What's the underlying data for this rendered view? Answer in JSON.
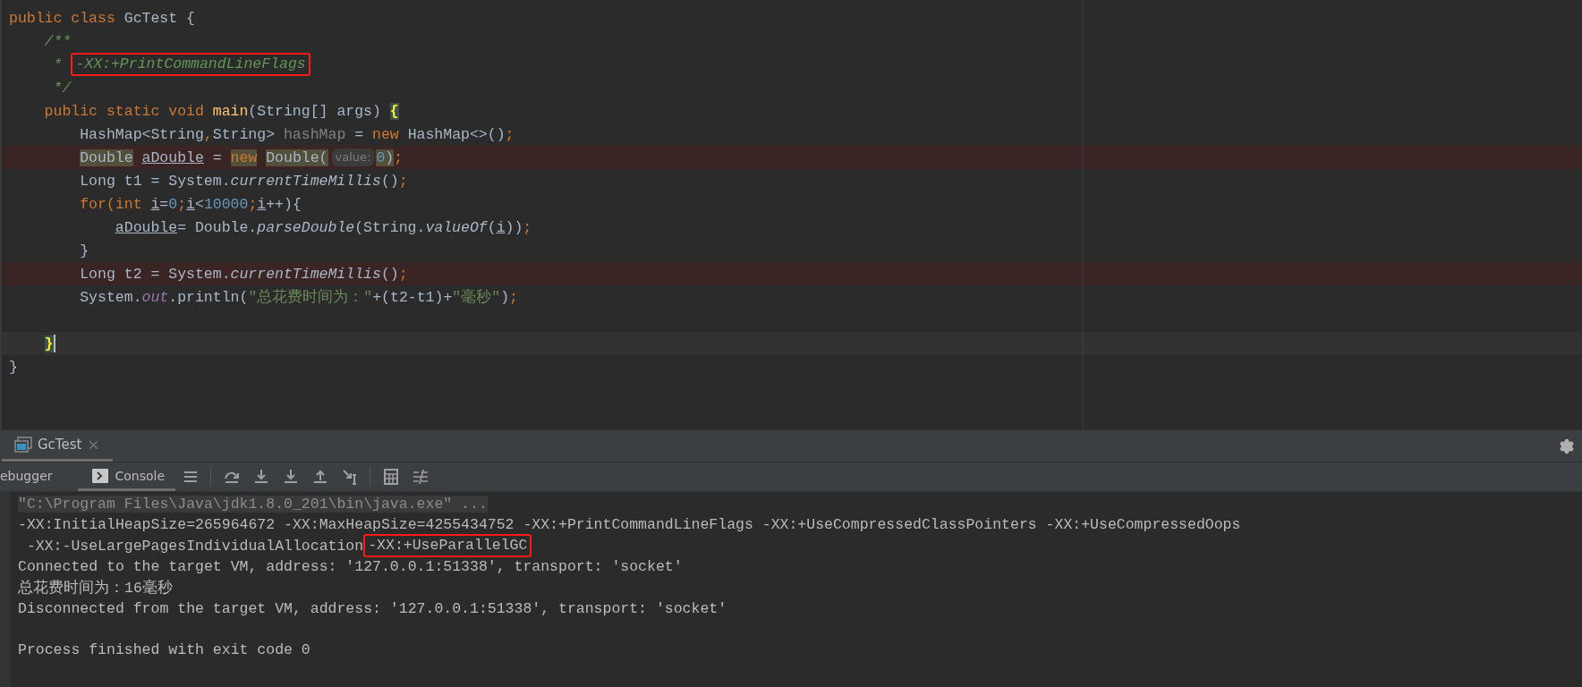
{
  "editor": {
    "lines": [
      {
        "kind": "normal",
        "tokens": [
          {
            "t": "public class",
            "kind": "kw"
          },
          {
            "t": " GcTest {",
            "kind": "plain"
          }
        ]
      },
      {
        "kind": "normal",
        "tokens": [
          {
            "t": "    /**",
            "kind": "comment"
          }
        ]
      },
      {
        "kind": "normal",
        "tokens": [
          {
            "t": "     * ",
            "kind": "comment"
          },
          {
            "t": "-XX:+PrintCommandLineFlags",
            "kind": "boxed-comment"
          }
        ]
      },
      {
        "kind": "normal",
        "tokens": [
          {
            "t": "     */",
            "kind": "comment"
          }
        ]
      },
      {
        "kind": "normal",
        "tokens": [
          {
            "t": "    public static void",
            "kind": "kw"
          },
          {
            "t": " main",
            "kind": "method"
          },
          {
            "t": "(String[] args) ",
            "kind": "plain"
          },
          {
            "t": "{",
            "kind": "brace"
          }
        ]
      },
      {
        "kind": "normal",
        "tokens": [
          {
            "t": "        HashMap<String",
            "kind": "plain"
          },
          {
            "t": ",",
            "kind": "kw"
          },
          {
            "t": "String> ",
            "kind": "plain"
          },
          {
            "t": "hashMap",
            "kind": "unused"
          },
          {
            "t": " = ",
            "kind": "plain"
          },
          {
            "t": "new",
            "kind": "kw"
          },
          {
            "t": " HashMap<>()",
            "kind": "plain"
          },
          {
            "t": ";",
            "kind": "kw"
          }
        ]
      },
      {
        "kind": "marked",
        "tokens": [
          {
            "t": "        Double",
            "kind": "marked-plain"
          },
          {
            "t": " aDouble",
            "kind": "reassigned"
          },
          {
            "t": " = ",
            "kind": "plain"
          },
          {
            "t": "new",
            "kind": "marked-kw"
          },
          {
            "t": " Double(",
            "kind": "marked-plain"
          },
          {
            "t": "value:",
            "kind": "hint"
          },
          {
            "t": "0",
            "kind": "marked-number"
          },
          {
            "t": ")",
            "kind": "marked-plain"
          },
          {
            "t": ";",
            "kind": "kw"
          }
        ]
      },
      {
        "kind": "normal",
        "tokens": [
          {
            "t": "        Long t1 = System.",
            "kind": "plain"
          },
          {
            "t": "currentTimeMillis",
            "kind": "static-call"
          },
          {
            "t": "()",
            "kind": "plain"
          },
          {
            "t": ";",
            "kind": "kw"
          }
        ]
      },
      {
        "kind": "normal",
        "tokens": [
          {
            "t": "        for(int ",
            "kind": "kw"
          },
          {
            "t": "i",
            "kind": "reassigned"
          },
          {
            "t": "=",
            "kind": "plain"
          },
          {
            "t": "0",
            "kind": "number"
          },
          {
            "t": ";",
            "kind": "kw"
          },
          {
            "t": "i",
            "kind": "reassigned"
          },
          {
            "t": "<",
            "kind": "plain"
          },
          {
            "t": "10000",
            "kind": "number"
          },
          {
            "t": ";",
            "kind": "kw"
          },
          {
            "t": "i",
            "kind": "reassigned"
          },
          {
            "t": "++){",
            "kind": "plain"
          }
        ]
      },
      {
        "kind": "normal",
        "tokens": [
          {
            "t": "            aDouble",
            "kind": "reassigned"
          },
          {
            "t": "= Double.",
            "kind": "plain"
          },
          {
            "t": "parseDouble",
            "kind": "static-call"
          },
          {
            "t": "(String.",
            "kind": "plain"
          },
          {
            "t": "valueOf",
            "kind": "static-call"
          },
          {
            "t": "(",
            "kind": "plain"
          },
          {
            "t": "i",
            "kind": "reassigned"
          },
          {
            "t": "))",
            "kind": "plain"
          },
          {
            "t": ";",
            "kind": "kw"
          }
        ]
      },
      {
        "kind": "normal",
        "tokens": [
          {
            "t": "        }",
            "kind": "plain"
          }
        ]
      },
      {
        "kind": "marked",
        "tokens": [
          {
            "t": "        Long t2 = System.",
            "kind": "plain"
          },
          {
            "t": "currentTimeMillis",
            "kind": "static-call"
          },
          {
            "t": "()",
            "kind": "plain"
          },
          {
            "t": ";",
            "kind": "kw"
          }
        ]
      },
      {
        "kind": "normal",
        "tokens": [
          {
            "t": "        System.",
            "kind": "plain"
          },
          {
            "t": "out",
            "kind": "static-field"
          },
          {
            "t": ".println(",
            "kind": "plain"
          },
          {
            "t": "\"总花费时间为：\"",
            "kind": "string"
          },
          {
            "t": "+(t2-t1)+",
            "kind": "plain"
          },
          {
            "t": "\"毫秒\"",
            "kind": "string"
          },
          {
            "t": ")",
            "kind": "plain"
          },
          {
            "t": ";",
            "kind": "kw"
          }
        ]
      },
      {
        "kind": "blank"
      },
      {
        "kind": "current",
        "tokens": [
          {
            "t": "    }",
            "kind": "brace"
          }
        ]
      },
      {
        "kind": "normal",
        "tokens": [
          {
            "t": "}",
            "kind": "plain"
          }
        ]
      }
    ]
  },
  "tool_window": {
    "tabs": [
      {
        "label": "GcTest",
        "selected": true
      }
    ],
    "sub_tabs": [
      {
        "label": "ebugger",
        "selected": false
      },
      {
        "label": "Console",
        "selected": true
      }
    ]
  },
  "console": {
    "lines": [
      {
        "kind": "text",
        "segments": [
          {
            "t": "\"C:\\Program Files\\Java\\jdk1.8.0_201\\bin\\java.exe\" ...",
            "kind": "command"
          }
        ]
      },
      {
        "kind": "text",
        "segments": [
          {
            "t": "-XX:InitialHeapSize=265964672 -XX:MaxHeapSize=4255434752 -XX:+PrintCommandLineFlags -XX:+UseCompressedClassPointers -XX:+UseCompressedOops",
            "kind": "plain"
          }
        ]
      },
      {
        "kind": "text",
        "segments": [
          {
            "t": " -XX:-UseLargePagesIndividualAllocation",
            "kind": "plain"
          },
          {
            "t": "-XX:+UseParallelGC",
            "kind": "boxed"
          }
        ]
      },
      {
        "kind": "text",
        "segments": [
          {
            "t": "Connected to the target VM, address: '127.0.0.1:51338', transport: 'socket'",
            "kind": "plain"
          }
        ]
      },
      {
        "kind": "text",
        "segments": [
          {
            "t": "总花费时间为：16毫秒",
            "kind": "plain"
          }
        ]
      },
      {
        "kind": "text",
        "segments": [
          {
            "t": "Disconnected from the target VM, address: '127.0.0.1:51338', transport: 'socket'",
            "kind": "plain"
          }
        ]
      },
      {
        "kind": "blank"
      },
      {
        "kind": "text",
        "segments": [
          {
            "t": "Process finished with exit code 0",
            "kind": "plain"
          }
        ]
      }
    ]
  }
}
